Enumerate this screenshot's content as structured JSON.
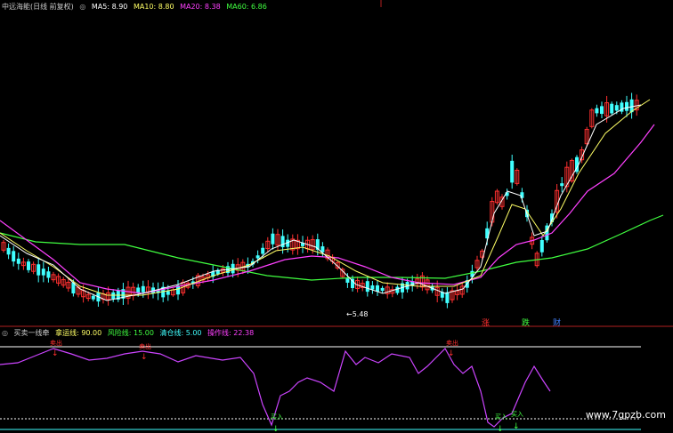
{
  "header": {
    "stock_title": "中远海能(日线 前复权)",
    "ma_items": [
      {
        "label": "MA5: 8.90",
        "color": "#ffffff"
      },
      {
        "label": "MA10: 8.80",
        "color": "#ffff66"
      },
      {
        "label": "MA20: 8.38",
        "color": "#ff40ff"
      },
      {
        "label": "MA60: 6.86",
        "color": "#40ff40"
      }
    ]
  },
  "indicator": {
    "title": "买卖一线牵",
    "items": [
      {
        "label": "拿运线: 90.00",
        "color": "#ffff66"
      },
      {
        "label": "风险线: 15.00",
        "color": "#40ff40"
      },
      {
        "label": "清仓线: 5.00",
        "color": "#40ffff"
      },
      {
        "label": "操作线: 22.38",
        "color": "#ff40ff"
      }
    ],
    "buy_label": "买入",
    "sell_label": "卖出"
  },
  "annotations": {
    "low_price": "5.48",
    "zhang": "涨",
    "die": "跌",
    "cai": "财"
  },
  "watermark": "www.7gpzb.com",
  "colors": {
    "up": "#ff3030",
    "down": "#40ffff",
    "ma5": "#ffffff",
    "ma10": "#ffff66",
    "ma20": "#ff40ff",
    "ma60": "#40ff40",
    "op_line": "#cc44ff"
  }
}
